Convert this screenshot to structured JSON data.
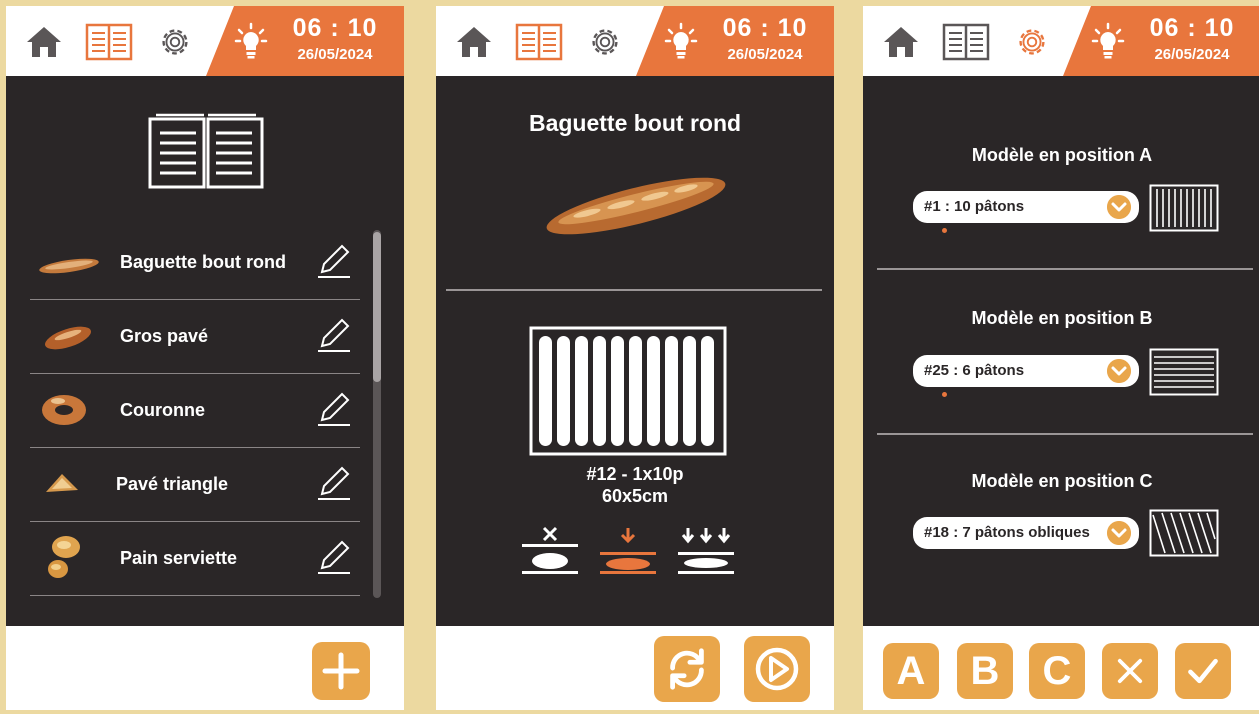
{
  "header": {
    "time": "06 : 10",
    "date": "26/05/2024",
    "icons": [
      "home-icon",
      "book-icon",
      "gear-icon",
      "lightbulb-icon"
    ]
  },
  "colors": {
    "background": "#ecd9a0",
    "screen": "#2a2627",
    "accent_orange": "#e8763d",
    "button_orange": "#e9a64b"
  },
  "screen1": {
    "book_icon": "open-book-icon",
    "recipes": [
      {
        "label": "Baguette bout rond",
        "icon": "baguette-thumbnail"
      },
      {
        "label": "Gros pavé",
        "icon": "gros-pave-thumbnail"
      },
      {
        "label": "Couronne",
        "icon": "couronne-thumbnail"
      },
      {
        "label": "Pavé triangle",
        "icon": "pave-triangle-thumbnail"
      },
      {
        "label": "Pain serviette",
        "icon": "pain-serviette-thumbnail"
      }
    ],
    "add_button_icon": "plus-icon"
  },
  "screen2": {
    "title": "Baguette bout rond",
    "mold_code": "#12 - 1x10p",
    "mold_size": "60x5cm",
    "selected_mode": 1,
    "footer_icons": [
      "refresh-icon",
      "play-icon"
    ]
  },
  "screen3": {
    "positions": [
      {
        "title": "Modèle en position A",
        "selection": "#1 : 10 pâtons",
        "mold": "vertical-lines"
      },
      {
        "title": "Modèle en position B",
        "selection": "#25 : 6 pâtons",
        "mold": "horizontal-lines"
      },
      {
        "title": "Modèle en position C",
        "selection": "#18 : 7 pâtons obliques",
        "mold": "diagonal-lines"
      }
    ],
    "footer_buttons": {
      "a": "A",
      "b": "B",
      "c": "C",
      "cancel_icon": "cancel-icon",
      "confirm_icon": "check-icon"
    }
  }
}
